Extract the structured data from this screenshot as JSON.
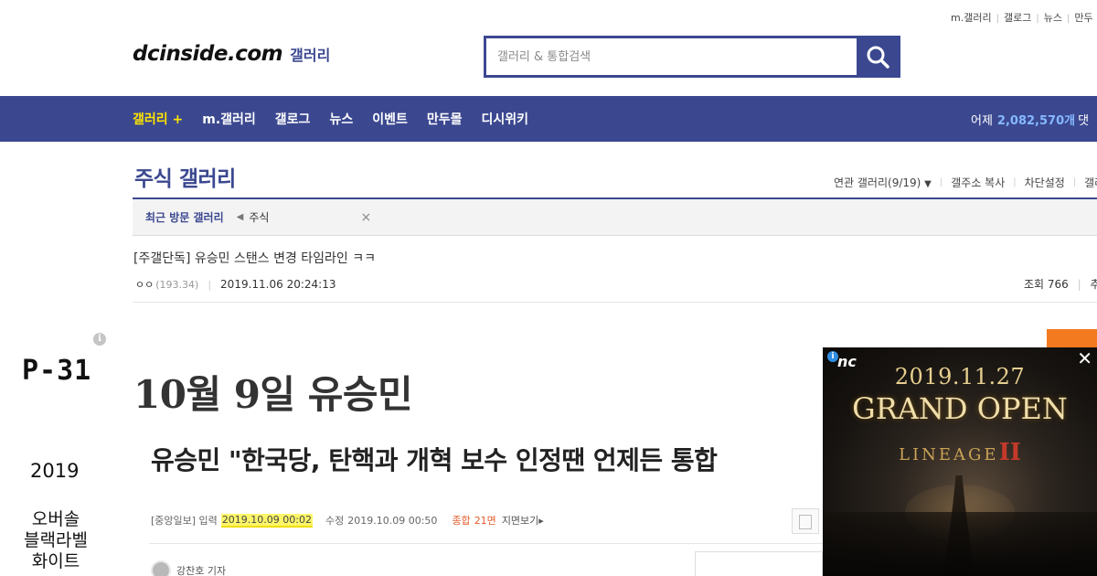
{
  "util_links": [
    "m.갤러리",
    "갤로그",
    "뉴스",
    "만두"
  ],
  "logo": {
    "main": "dcinside.com",
    "sub": "갤러리"
  },
  "search": {
    "placeholder": "갤러리 & 통합검색",
    "icon": "search-icon"
  },
  "nav": {
    "items": [
      "갤러리 +",
      "m.갤러리",
      "갤로그",
      "뉴스",
      "이벤트",
      "만두몰",
      "디시위키"
    ],
    "stats_label": "어제",
    "stats_value": "2,082,570개",
    "stats_suffix": "댓"
  },
  "gallery": {
    "title": "주식 갤러리",
    "tools": [
      "연관 갤러리(9/19)",
      "갤주소 복사",
      "차단설정",
      "갤러"
    ]
  },
  "recent": {
    "label": "최근 방문 갤러리",
    "item": "주식",
    "close": "×"
  },
  "post": {
    "title": "[주갤단독] 유승민 스탠스 변경 타임라인 ㅋㅋ",
    "author": "ㅇㅇ",
    "ip": "(193.34)",
    "date": "2019.11.06 20:24:13",
    "views": "조회 766",
    "more": "추"
  },
  "sidebar_ad": {
    "info": "i",
    "code": "P-31",
    "year": "2019",
    "desc_lines": [
      "오버솔",
      "블랙라벨",
      "화이트"
    ]
  },
  "body": {
    "heading": "10월 9일 유승민",
    "headline": "유승민 \"한국당, 탄핵과 개혁 보수 인정땐 언제든 통합",
    "meta_source": "[중앙일보] 입력",
    "meta_input_date": "2019.10.09 00:02",
    "meta_edit_label": "수정",
    "meta_edit_date": "2019.10.09 00:50",
    "meta_comment_label": "종합",
    "meta_comment_count": "21면",
    "meta_view": "지면보기▸",
    "reporter": "강찬호 기자"
  },
  "video_ad": {
    "brand": "nc",
    "date": "2019.11.27",
    "headline": "GRAND OPEN",
    "logo_text": "LINEAGE",
    "logo_numeral": "II",
    "close": "✕"
  },
  "colors": {
    "brand": "#3b4890",
    "nav_active": "#ffe400",
    "stat_number": "#85b8ff",
    "highlight": "#fdf66a",
    "accent_orange": "#f47a20"
  }
}
